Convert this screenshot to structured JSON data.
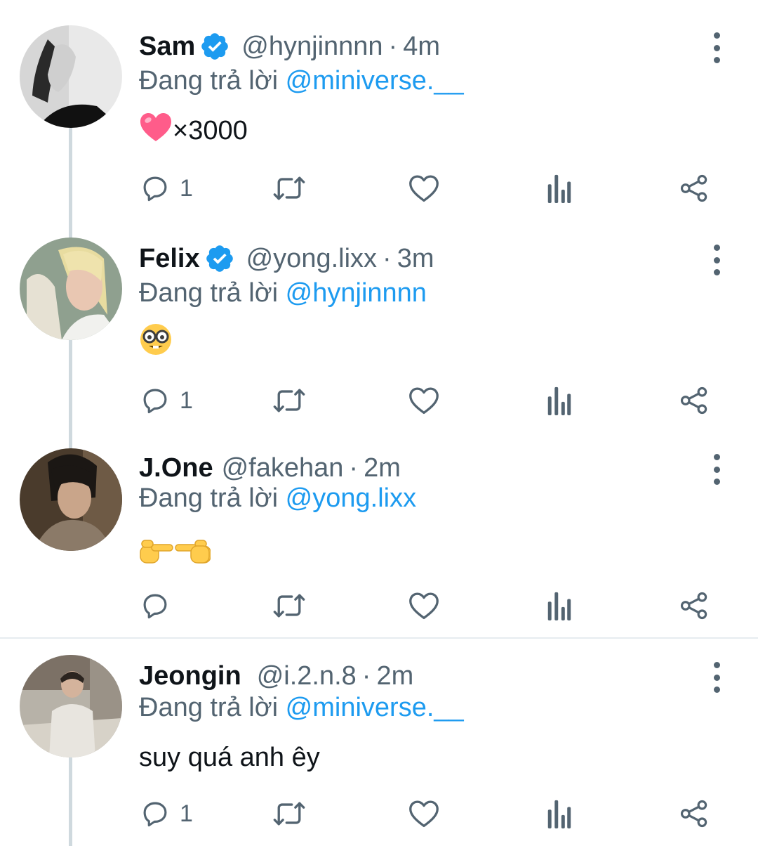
{
  "reply_prefix": "Đang trả lời",
  "colors": {
    "accent": "#1d9bf0",
    "secondary": "#536471",
    "thread_line": "#cfd9de"
  },
  "tweets": [
    {
      "name": "Sam",
      "verified": true,
      "handle": "@hynjinnnn",
      "time": "4m",
      "reply_to": "@miniverse.__",
      "content_text": "×3000",
      "content_emoji": "pink-heart",
      "reply_count": "1"
    },
    {
      "name": "Felix",
      "verified": true,
      "handle": "@yong.lixx",
      "time": "3m",
      "reply_to": "@hynjinnnn",
      "content_text": "",
      "content_emoji": "nerd-face",
      "reply_count": "1"
    },
    {
      "name": "J.One",
      "verified": false,
      "handle": "@fakehan",
      "time": "2m",
      "reply_to": "@yong.lixx",
      "content_text": "",
      "content_emoji": "pointing-fingers",
      "reply_count": ""
    },
    {
      "name": "Jeongin",
      "verified": false,
      "handle": "@i.2.n.8",
      "time": "2m",
      "reply_to": "@miniverse.__",
      "content_text": "suy quá anh êy",
      "content_emoji": "",
      "reply_count": "1"
    }
  ],
  "sep": "·"
}
